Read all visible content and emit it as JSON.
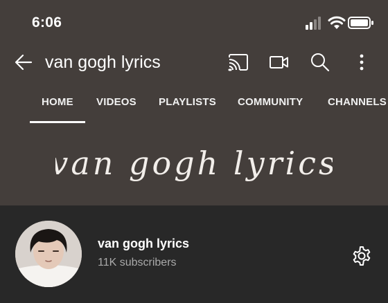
{
  "status_bar": {
    "time": "6:06",
    "icons": [
      "cellular-signal-icon",
      "wifi-icon",
      "battery-icon"
    ]
  },
  "app_bar": {
    "title": "van gogh lyrics",
    "actions": [
      "cast-icon",
      "camera-icon",
      "search-icon",
      "more-icon"
    ]
  },
  "tabs": [
    {
      "label": "HOME",
      "selected": true
    },
    {
      "label": "VIDEOS",
      "selected": false
    },
    {
      "label": "PLAYLISTS",
      "selected": false
    },
    {
      "label": "COMMUNITY",
      "selected": false
    },
    {
      "label": "CHANNELS",
      "selected": false
    }
  ],
  "banner": {
    "text": "van gogh lyrics"
  },
  "channel": {
    "name": "van gogh lyrics",
    "subscribers": "11K subscribers"
  },
  "colors": {
    "header_bg": "#443e3b",
    "body_bg": "#282828",
    "text_primary": "#ffffff",
    "text_secondary": "#aaaaaa"
  }
}
